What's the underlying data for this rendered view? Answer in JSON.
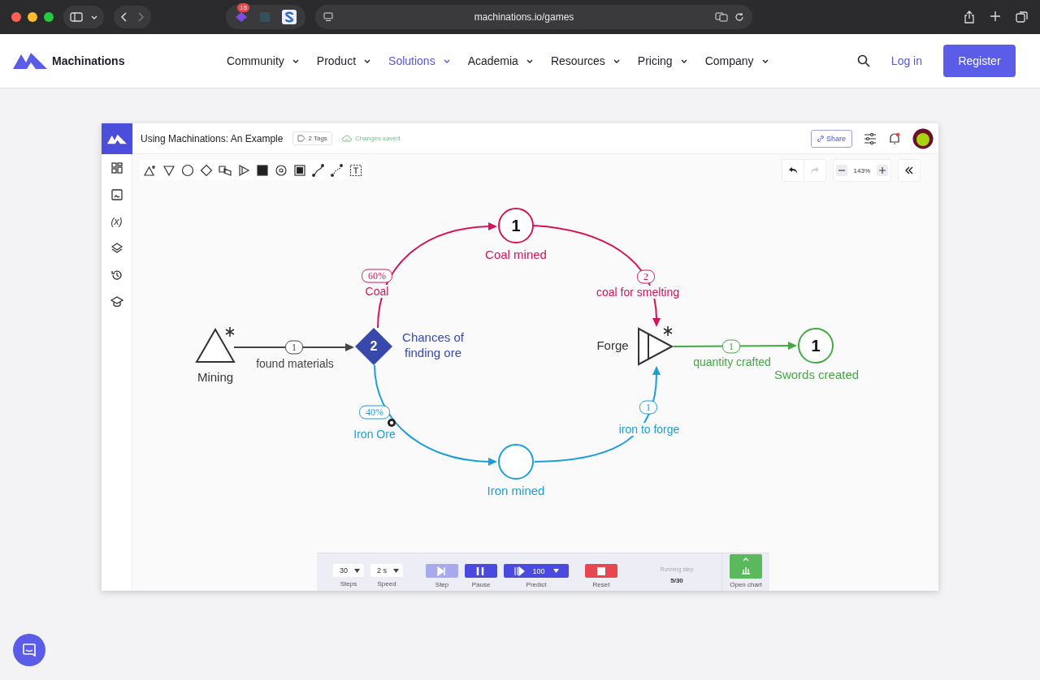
{
  "browser": {
    "url": "machinations.io/games",
    "tab_badge": "15"
  },
  "nav": {
    "brand": "Machinations",
    "items": [
      {
        "label": "Community",
        "selected": false
      },
      {
        "label": "Product",
        "selected": false
      },
      {
        "label": "Solutions",
        "selected": true
      },
      {
        "label": "Academia",
        "selected": false
      },
      {
        "label": "Resources",
        "selected": false
      },
      {
        "label": "Pricing",
        "selected": false
      },
      {
        "label": "Company",
        "selected": false
      }
    ],
    "login": "Log in",
    "register": "Register"
  },
  "editor": {
    "title": "Using Machinations: An Example",
    "tags": "2 Tags",
    "save_status": "Changes saved",
    "share": "Share",
    "zoom": "143%",
    "variables_glyph": "(x)"
  },
  "diagram": {
    "nodes": [
      {
        "kind": "source",
        "label": "Mining",
        "color": "#333333"
      },
      {
        "kind": "gate",
        "label": "Chances of finding ore",
        "value": "2",
        "color": "#3949ab"
      },
      {
        "kind": "pool",
        "label": "Coal mined",
        "value": "1",
        "color": "#d3145a"
      },
      {
        "kind": "pool",
        "label": "Iron mined",
        "color": "#1a9fd9"
      },
      {
        "kind": "converter",
        "label": "Forge",
        "color": "#333333"
      },
      {
        "kind": "pool",
        "label": "Swords created",
        "value": "1",
        "color": "#43a843"
      }
    ],
    "connections": [
      {
        "label": "found materials",
        "value": "1",
        "color": "#444444"
      },
      {
        "label": "Coal",
        "value": "60%",
        "color": "#d3145a"
      },
      {
        "label": "Iron Ore",
        "value": "40%",
        "color": "#1a9fd9"
      },
      {
        "label": "coal for smelting",
        "value": "2",
        "color": "#d3145a"
      },
      {
        "label": "iron to forge",
        "value": "1",
        "color": "#1a9fd9"
      },
      {
        "label": "quantity crafted",
        "value": "1",
        "color": "#43a843"
      }
    ]
  },
  "simulation": {
    "steps": "30",
    "steps_label": "Steps",
    "speed": "2 s",
    "speed_label": "Speed",
    "buttons": [
      {
        "kind": "step",
        "label": "Step",
        "disabled": true
      },
      {
        "kind": "pause",
        "label": "Pause",
        "disabled": false
      },
      {
        "kind": "predict",
        "label": "Predict",
        "count": "100",
        "disabled": false
      },
      {
        "kind": "reset",
        "label": "Reset",
        "disabled": false
      }
    ],
    "running_label": "Running step",
    "running_value": "5/30",
    "chart_label": "Open chart"
  }
}
